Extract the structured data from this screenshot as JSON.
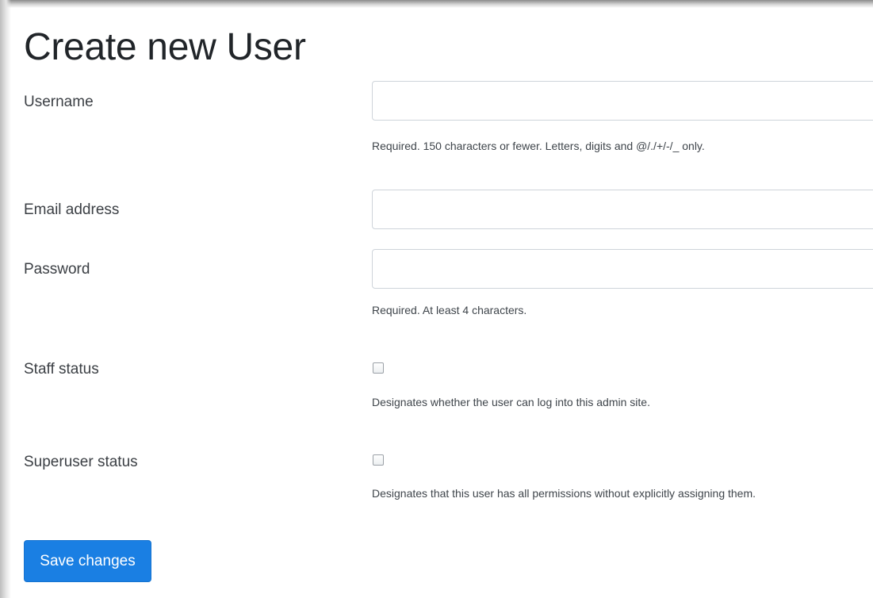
{
  "page": {
    "title": "Create new User"
  },
  "form": {
    "username": {
      "label": "Username",
      "value": "",
      "help": "Required. 150 characters or fewer. Letters, digits and @/./+/-/_ only."
    },
    "email": {
      "label": "Email address",
      "value": ""
    },
    "password": {
      "label": "Password",
      "value": "",
      "help": "Required. At least 4 characters."
    },
    "staff_status": {
      "label": "Staff status",
      "checked": false,
      "help": "Designates whether the user can log into this admin site."
    },
    "superuser_status": {
      "label": "Superuser status",
      "checked": false,
      "help": "Designates that this user has all permissions without explicitly assigning them."
    }
  },
  "actions": {
    "save_label": "Save changes"
  },
  "colors": {
    "primary": "#1a7fe3",
    "border": "#ced4da",
    "text": "#212529"
  }
}
